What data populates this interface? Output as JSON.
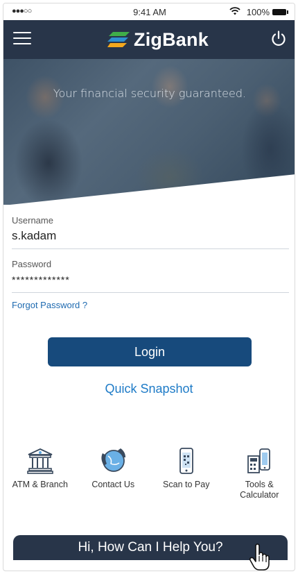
{
  "status_bar": {
    "signal": "●●●○○",
    "time": "9:41 AM",
    "battery_pct": "100%"
  },
  "header": {
    "brand_name": "ZigBank",
    "menu_icon": "hamburger-icon",
    "power_icon": "power-icon"
  },
  "hero": {
    "tagline": "Your financial security guaranteed."
  },
  "login_form": {
    "username_label": "Username",
    "username_value": "s.kadam",
    "password_label": "Password",
    "password_value": "*************",
    "forgot_password": "Forgot Password ?",
    "login_button": "Login",
    "quick_snapshot": "Quick Snapshot"
  },
  "quick_links": [
    {
      "label": "ATM & Branch",
      "icon": "bank-building-icon"
    },
    {
      "label": "Contact Us",
      "icon": "phone-globe-icon"
    },
    {
      "label": "Scan to Pay",
      "icon": "phone-qr-icon"
    },
    {
      "label": "Tools &\nCalculator",
      "icon": "calculator-icon"
    }
  ],
  "help_bar": {
    "text": "Hi, How Can I Help You?"
  },
  "colors": {
    "header_bg": "#283549",
    "primary_button": "#174a7c",
    "link": "#1e7bc7"
  }
}
